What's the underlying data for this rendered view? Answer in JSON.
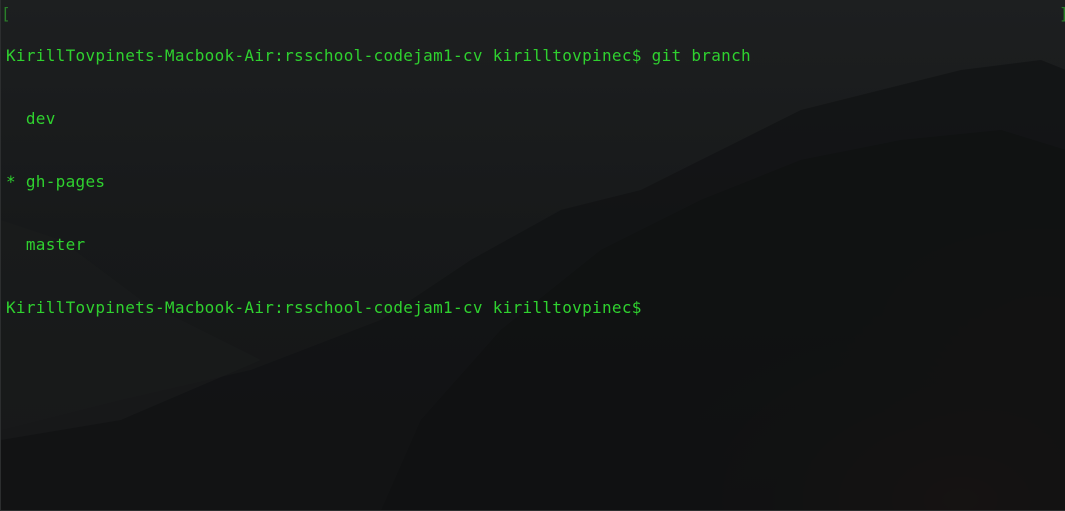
{
  "terminal": {
    "prompt": "KirillTovpinets-Macbook-Air:rsschool-codejam1-cv kirilltovpinec$",
    "command": "git branch",
    "branches": [
      {
        "marker": " ",
        "name": "dev"
      },
      {
        "marker": "*",
        "name": "gh-pages"
      },
      {
        "marker": " ",
        "name": "master"
      }
    ],
    "brackets": {
      "left": "[",
      "right": "]"
    }
  },
  "colors": {
    "text": "#2fd12f",
    "background": "#151617"
  }
}
